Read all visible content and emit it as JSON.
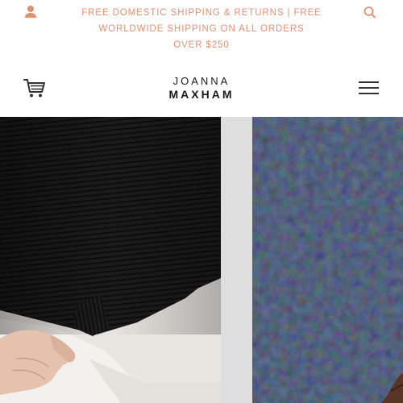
{
  "announcement": {
    "lines": [
      "FREE DOMESTIC SHIPPING & RETURNS | FREE",
      "WORLDWIDE SHIPPING ON ALL ORDERS",
      "OVER $250"
    ]
  },
  "brand": {
    "line1": "JOANNA",
    "line2": "MAXHAM"
  },
  "icons": {
    "account": "account-icon",
    "search": "search-icon",
    "cart": "cart-icon",
    "menu": "hamburger-menu-icon"
  },
  "colors": {
    "announcement_text": "#e3906f",
    "account_icon": "#e3906f",
    "search_icon": "#e3906f",
    "logo": "#1a1a1a",
    "cart_icon": "#333333",
    "menu_icon": "#333333",
    "hero_divider": "#dedede"
  },
  "hero": {
    "left_image": "black-ribbed-sweater-photo",
    "right_image": "navy-boucle-coat-photo"
  }
}
